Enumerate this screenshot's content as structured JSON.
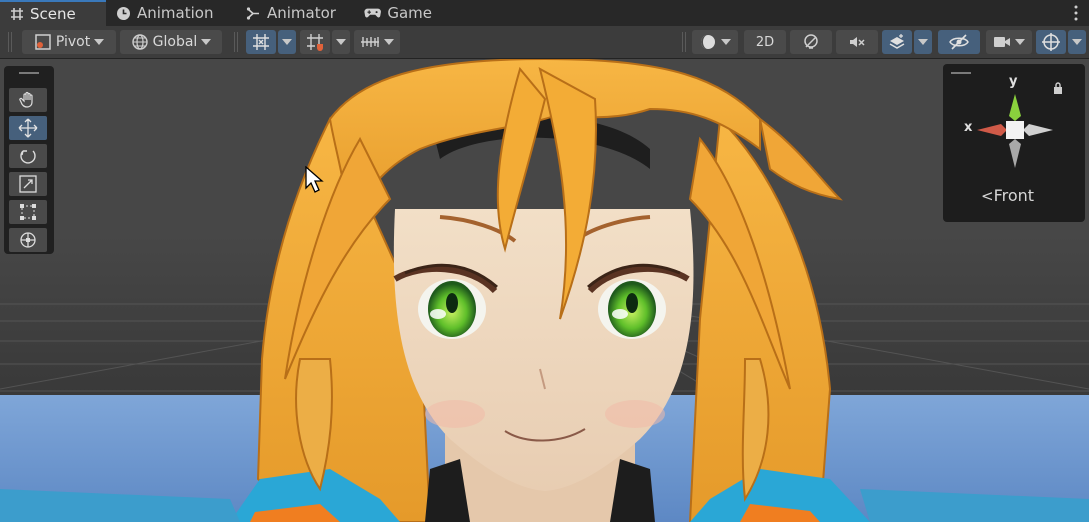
{
  "tabs": [
    {
      "label": "Scene",
      "icon": "grid-icon",
      "active": true
    },
    {
      "label": "Animation",
      "icon": "clock-icon",
      "active": false
    },
    {
      "label": "Animator",
      "icon": "animator-icon",
      "active": false
    },
    {
      "label": "Game",
      "icon": "gamepad-icon",
      "active": false
    }
  ],
  "toolbar": {
    "pivot_label": "Pivot",
    "global_label": "Global",
    "mode_2d_label": "2D"
  },
  "tools": [
    {
      "name": "hand-tool",
      "active": false
    },
    {
      "name": "move-tool",
      "active": true
    },
    {
      "name": "rotate-tool",
      "active": false
    },
    {
      "name": "scale-tool",
      "active": false
    },
    {
      "name": "rect-tool",
      "active": false
    },
    {
      "name": "transform-tool",
      "active": false
    }
  ],
  "gizmo": {
    "y_label": "y",
    "x_label": "x",
    "view_label": "Front"
  },
  "colors": {
    "accent": "#46607c",
    "tab_active_line": "#3a79bb",
    "hair": "#f2a93a",
    "eyes": "#6fcf2e"
  }
}
